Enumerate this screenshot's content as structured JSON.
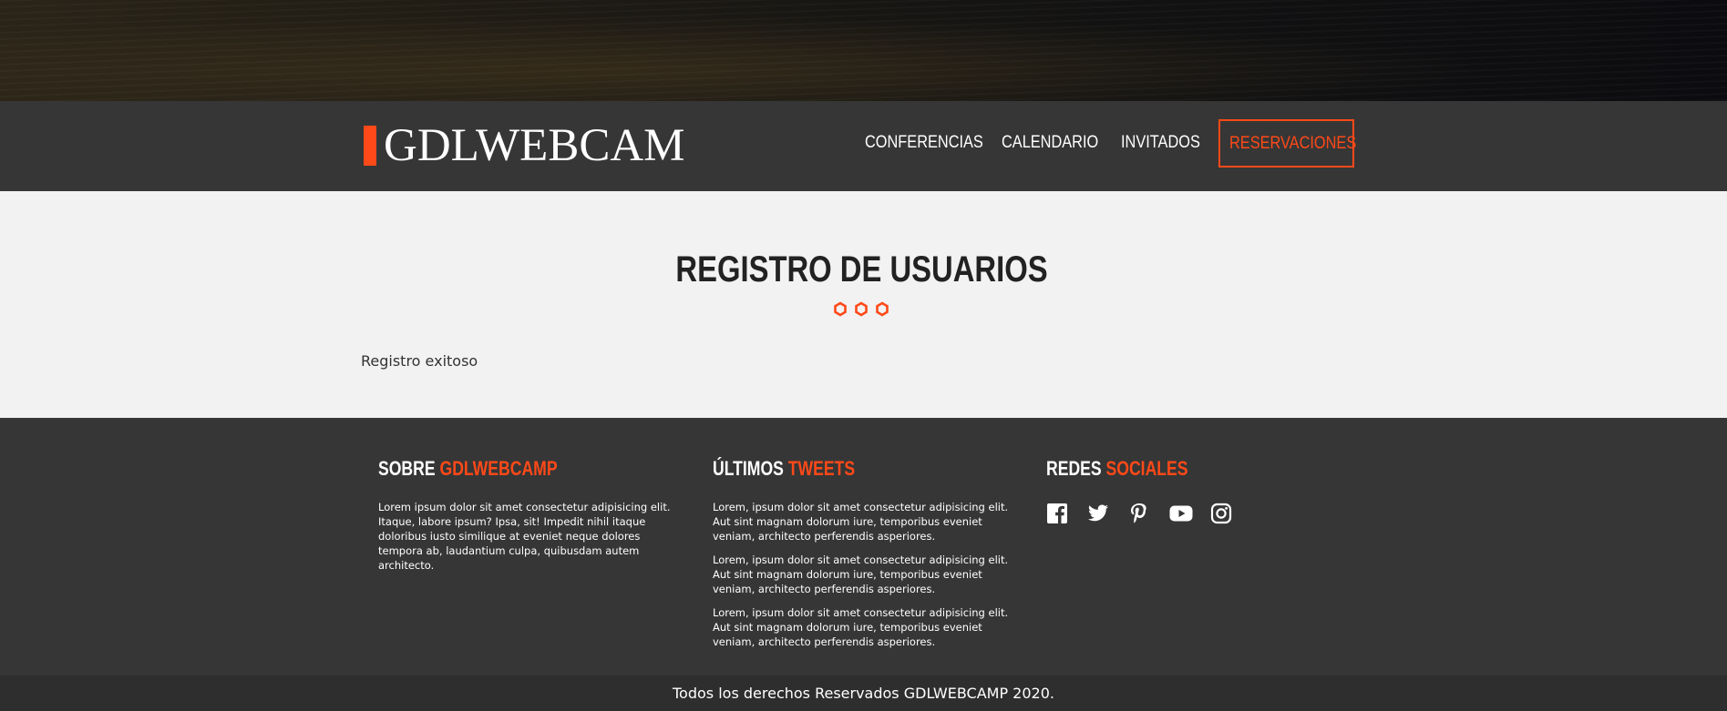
{
  "header": {
    "logo_text": "GDLWEBCAM",
    "nav": [
      {
        "label": "CONFERENCIAS"
      },
      {
        "label": "CALENDARIO"
      },
      {
        "label": "INVITADOS"
      },
      {
        "label": "RESERVACIONES",
        "active": true
      }
    ]
  },
  "main": {
    "title": "REGISTRO DE USUARIOS",
    "message": "Registro exitoso"
  },
  "footer": {
    "about": {
      "title_prefix": "SOBRE",
      "title_accent": "GDLWEBCAMP",
      "text": "Lorem ipsum dolor sit amet consectetur adipisicing elit. Itaque, labore ipsum? Ipsa, sit! Impedit nihil itaque doloribus iusto similique at eveniet neque dolores tempora ab, laudantium culpa, quibusdam autem architecto."
    },
    "tweets": {
      "title_prefix": "ÚLTIMOS",
      "title_accent": "TWEETS",
      "items": [
        "Lorem, ipsum dolor sit amet consectetur adipisicing elit. Aut sint magnam dolorum iure, temporibus eveniet veniam, architecto perferendis asperiores.",
        "Lorem, ipsum dolor sit amet consectetur adipisicing elit. Aut sint magnam dolorum iure, temporibus eveniet veniam, architecto perferendis asperiores.",
        "Lorem, ipsum dolor sit amet consectetur adipisicing elit. Aut sint magnam dolorum iure, temporibus eveniet veniam, architecto perferendis asperiores."
      ]
    },
    "social": {
      "title_prefix": "REDES",
      "title_accent": "SOCIALES",
      "icons": [
        "facebook-icon",
        "twitter-icon",
        "pinterest-icon",
        "youtube-icon",
        "instagram-icon"
      ]
    },
    "copyright": "Todos los derechos Reservados GDLWEBCAMP 2020."
  },
  "colors": {
    "accent": "#fe4918",
    "bar": "#363636",
    "page": "#f2f2f2"
  }
}
